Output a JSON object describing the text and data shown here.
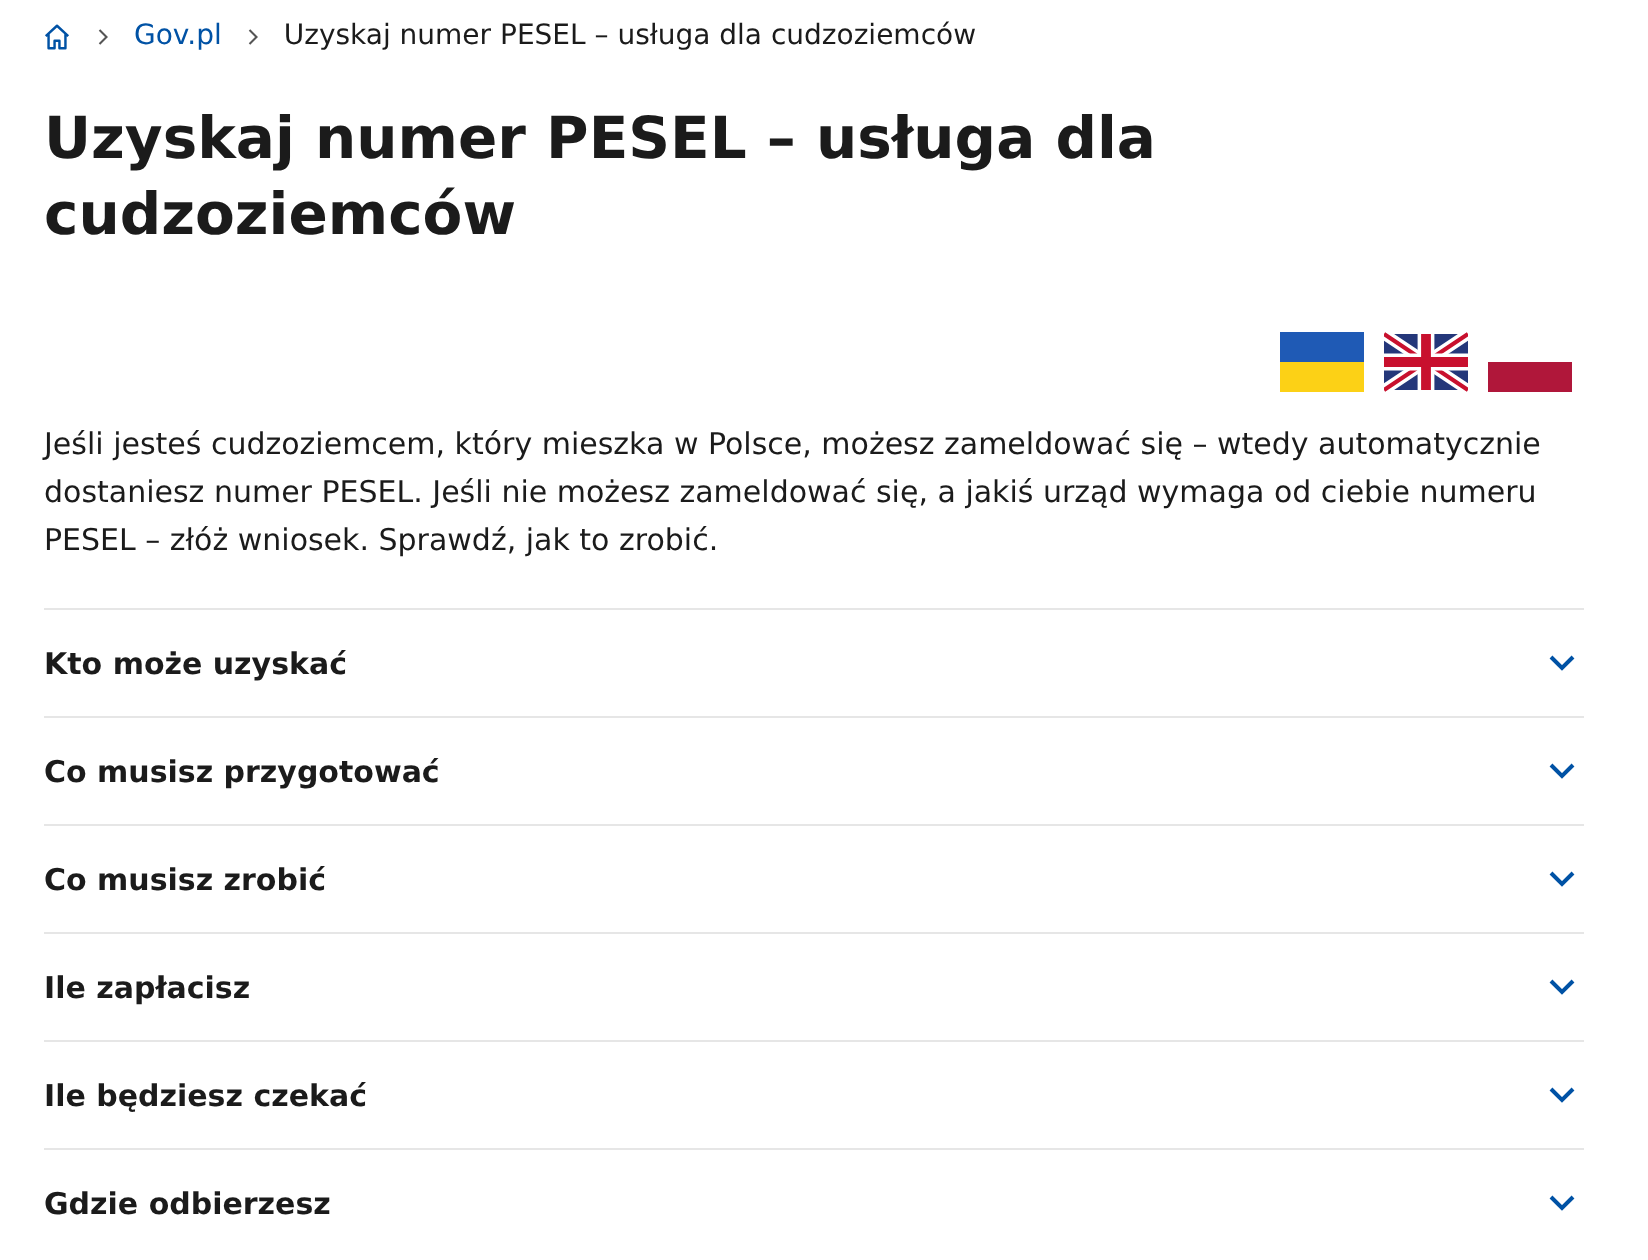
{
  "breadcrumbs": [
    {
      "label": "Gov.pl",
      "link": true
    },
    {
      "label": "Uzyskaj numer PESEL – usługa dla cudzoziemców",
      "link": false
    }
  ],
  "title": "Uzyskaj numer PESEL – usługa dla cudzoziemców",
  "intro": "Jeśli jesteś cudzoziemcem, który mieszka w Polsce, możesz zameldować się – wtedy automatycznie dostaniesz numer PESEL. Jeśli nie możesz zameldować się, a jakiś urząd wymaga od ciebie numeru PESEL – złóż wniosek. Sprawdź, jak to zrobić.",
  "sections": [
    {
      "label": "Kto może uzyskać",
      "expanded": false
    },
    {
      "label": "Co musisz przygotować",
      "expanded": false
    },
    {
      "label": "Co musisz zrobić",
      "expanded": false
    },
    {
      "label": "Ile zapłacisz",
      "expanded": false
    },
    {
      "label": "Ile będziesz czekać",
      "expanded": false
    },
    {
      "label": "Gdzie odbierzesz",
      "expanded": false
    }
  ]
}
